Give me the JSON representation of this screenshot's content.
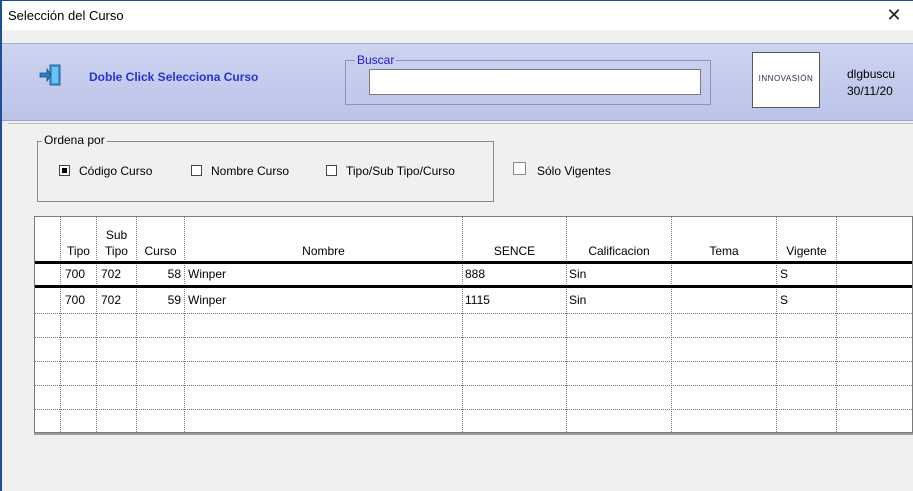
{
  "window": {
    "title": "Selección del Curso",
    "close_symbol": "✕"
  },
  "header": {
    "hint": "Doble Click Selecciona Curso",
    "search_label": "Buscar",
    "search_value": "",
    "logo_text": "INNOVASIÓN",
    "meta_line1": "dlgbuscu",
    "meta_line2": "30/11/20",
    "exit_icon": "exit-door-icon"
  },
  "sort": {
    "legend": "Ordena por",
    "options": [
      {
        "label": "Código Curso",
        "checked": true
      },
      {
        "label": "Nombre Curso",
        "checked": false
      },
      {
        "label": "Tipo/Sub Tipo/Curso",
        "checked": false
      }
    ],
    "vigentes_label": "Sólo Vigentes",
    "vigentes_checked": false
  },
  "grid": {
    "headers": {
      "tipo": "Tipo",
      "subtipo_1": "Sub",
      "subtipo_2": "Tipo",
      "curso": "Curso",
      "nombre": "Nombre",
      "sence": "SENCE",
      "calificacion": "Calificacion",
      "tema": "Tema",
      "vigente": "Vigente"
    },
    "rows": [
      {
        "tipo": "700",
        "subtipo": "702",
        "curso": "58",
        "nombre": "Winper",
        "sence": "888",
        "calificacion": "Sin",
        "tema": "",
        "vigente": "S"
      },
      {
        "tipo": "700",
        "subtipo": "702",
        "curso": "59",
        "nombre": "Winper",
        "sence": "1115",
        "calificacion": "Sin",
        "tema": "",
        "vigente": "S"
      }
    ]
  },
  "colors": {
    "header_bg": "#c4cbee",
    "hint_text": "#2433d6",
    "frame": "#1c4e9c"
  }
}
